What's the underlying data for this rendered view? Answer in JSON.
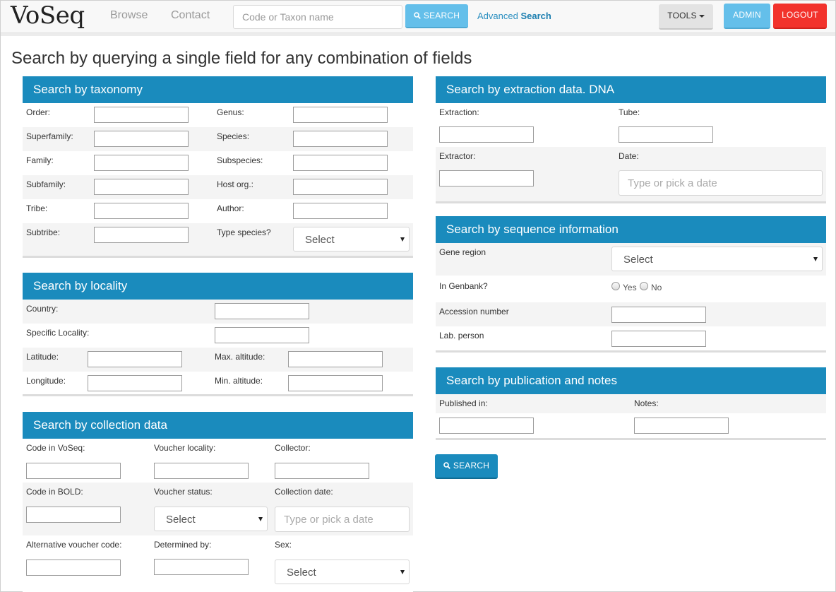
{
  "nav": {
    "brand": "VoSeq",
    "browse": "Browse",
    "contact": "Contact",
    "search_placeholder": "Code or Taxon name",
    "search_button": "SEARCH",
    "advanced_prefix": "Advanced",
    "advanced_bold": "Search",
    "tools": "TOOLS",
    "admin": "ADMIN",
    "logout": "LOGOUT"
  },
  "page_title": "Search by querying a single field for any combination of fields",
  "taxonomy": {
    "title": "Search by taxonomy",
    "order": "Order:",
    "genus": "Genus:",
    "superfamily": "Superfamily:",
    "species": "Species:",
    "family": "Family:",
    "subspecies": "Subspecies:",
    "subfamily": "Subfamily:",
    "host_org": "Host org.:",
    "tribe": "Tribe:",
    "author": "Author:",
    "subtribe": "Subtribe:",
    "type_species": "Type species?",
    "type_species_value": "Select"
  },
  "locality": {
    "title": "Search by locality",
    "country": "Country:",
    "specific_locality": "Specific Locality:",
    "latitude": "Latitude:",
    "max_altitude": "Max. altitude:",
    "longitude": "Longitude:",
    "min_altitude": "Min. altitude:"
  },
  "collection": {
    "title": "Search by collection data",
    "code_voseq": "Code in VoSeq:",
    "voucher_locality": "Voucher locality:",
    "collector": "Collector:",
    "code_bold": "Code in BOLD:",
    "voucher_status": "Voucher status:",
    "collection_date": "Collection date:",
    "voucher_status_value": "Select",
    "collection_date_placeholder": "Type or pick a date",
    "alt_voucher": "Alternative voucher code:",
    "determined_by": "Determined by:",
    "sex": "Sex:",
    "sex_value": "Select"
  },
  "extraction": {
    "title": "Search by extraction data. DNA",
    "extraction": "Extraction:",
    "tube": "Tube:",
    "extractor": "Extractor:",
    "date": "Date:",
    "date_placeholder": "Type or pick a date"
  },
  "sequence": {
    "title": "Search by sequence information",
    "gene_region": "Gene region",
    "gene_region_value": "Select",
    "in_genbank": "In Genbank?",
    "yes": "Yes",
    "no": "No",
    "accession": "Accession number",
    "lab_person": "Lab. person"
  },
  "publication": {
    "title": "Search by publication and notes",
    "published_in": "Published in:",
    "notes": "Notes:"
  },
  "bottom_search": "SEARCH",
  "colors": {
    "panel_header": "#1a8bbd",
    "light_button": "#64bfea",
    "logout": "#f2322c"
  }
}
